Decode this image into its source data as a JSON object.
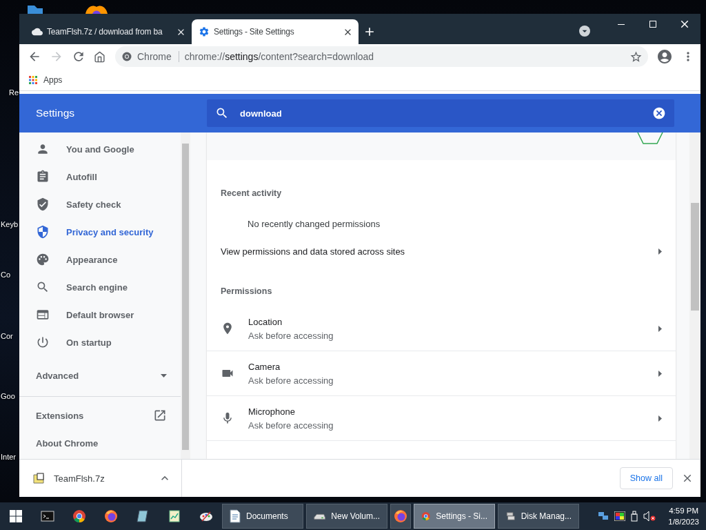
{
  "desktop": {
    "icon_labels": [
      {
        "label": "Re"
      },
      {
        "label": "Keyb"
      },
      {
        "label": "Co"
      },
      {
        "label": "Cor"
      },
      {
        "label": "Goo"
      },
      {
        "label": "Inter"
      }
    ]
  },
  "browser": {
    "tabs": [
      {
        "kind": "cloud",
        "title": "TeamFlsh.7z / download from ba",
        "selected": false
      },
      {
        "kind": "gear",
        "title": "Settings - Site Settings",
        "selected": true
      }
    ],
    "nav_buttons": [
      {
        "kind": "back",
        "disabled": false
      },
      {
        "kind": "forward",
        "disabled": true
      },
      {
        "kind": "reload",
        "disabled": false
      },
      {
        "kind": "home",
        "disabled": false
      }
    ],
    "omnibox": {
      "chip": "Chrome",
      "url": "chrome://**settings**/content?search=download"
    },
    "bookmarks": [
      {
        "label": "Apps"
      }
    ]
  },
  "settings": {
    "title": "Settings",
    "search": {
      "value": "download"
    },
    "sidebar": {
      "items": [
        {
          "kind": "person",
          "label": "You and Google",
          "selected": false
        },
        {
          "kind": "clipboard",
          "label": "Autofill",
          "selected": false
        },
        {
          "kind": "shieldcheck",
          "label": "Safety check",
          "selected": false
        },
        {
          "kind": "shield",
          "label": "Privacy and security",
          "selected": true
        },
        {
          "kind": "palette",
          "label": "Appearance",
          "selected": false
        },
        {
          "kind": "search",
          "label": "Search engine",
          "selected": false
        },
        {
          "kind": "browser",
          "label": "Default browser",
          "selected": false
        },
        {
          "kind": "power",
          "label": "On startup",
          "selected": false
        }
      ],
      "advanced": {
        "label": "Advanced",
        "expanded": false
      },
      "links": [
        {
          "label": "Extensions",
          "external": true
        },
        {
          "label": "About Chrome",
          "external": false
        }
      ]
    },
    "recent_activity": {
      "heading": "Recent activity",
      "empty_text": "No recently changed permissions"
    },
    "all_sites_row": {
      "label": "View permissions and data stored across sites"
    },
    "permissions": {
      "heading": "Permissions",
      "items": [
        {
          "kind": "location",
          "name": "Location",
          "status": "Ask before accessing"
        },
        {
          "kind": "camera",
          "name": "Camera",
          "status": "Ask before accessing"
        },
        {
          "kind": "mic",
          "name": "Microphone",
          "status": "Ask before accessing"
        }
      ]
    }
  },
  "download_shelf": {
    "items": [
      {
        "name": "TeamFlsh.7z"
      }
    ],
    "show_all": "Show all"
  },
  "taskbar": {
    "pinned": [
      {
        "kind": "terminal"
      },
      {
        "kind": "chrome"
      },
      {
        "kind": "firefox"
      },
      {
        "kind": "notebook"
      },
      {
        "kind": "spreadsheet"
      },
      {
        "kind": "paint"
      }
    ],
    "windows": [
      {
        "kind": "document",
        "label": "Documents",
        "selected": false
      },
      {
        "kind": "drive",
        "label": "New Volum...",
        "selected": false
      },
      {
        "kind": "firefox",
        "selected": false
      },
      {
        "kind": "chrome",
        "label": "Settings - Si...",
        "selected": true
      },
      {
        "kind": "disk",
        "label": "Disk Manag...",
        "selected": false
      }
    ],
    "time": "4:59 PM",
    "date": "1/8/2023"
  }
}
